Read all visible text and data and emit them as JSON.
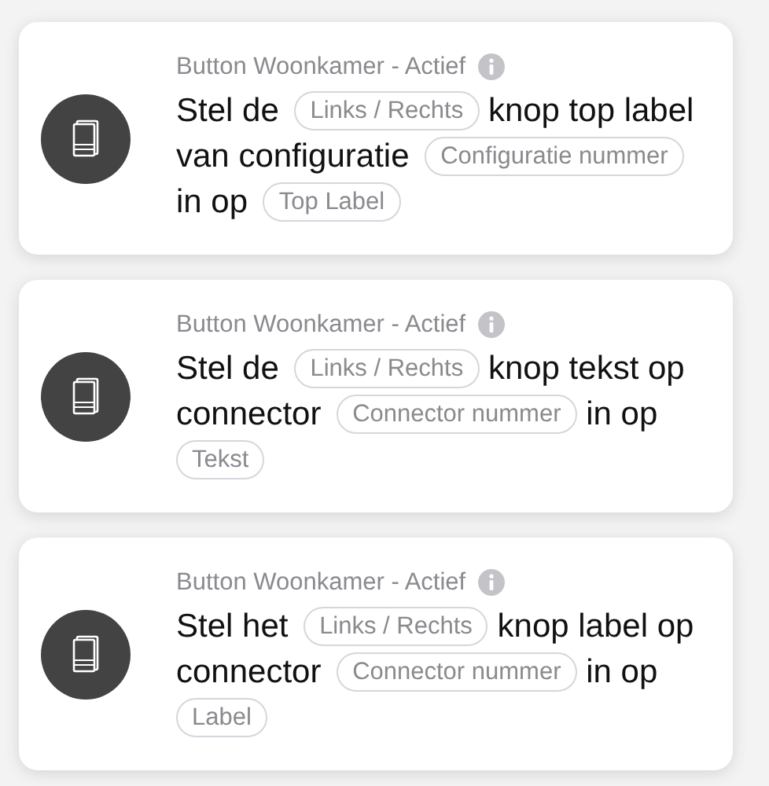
{
  "cards": [
    {
      "title": "Button Woonkamer - Actief",
      "sentence": [
        {
          "kind": "text",
          "text": "Stel de"
        },
        {
          "kind": "field",
          "placeholder": "Links / Rechts"
        },
        {
          "kind": "text",
          "text": "knop top label"
        },
        {
          "kind": "text",
          "text": "van configuratie"
        },
        {
          "kind": "field",
          "placeholder": "Configuratie nummer"
        },
        {
          "kind": "text",
          "text": "in op"
        },
        {
          "kind": "field",
          "placeholder": "Top Label"
        }
      ]
    },
    {
      "title": "Button Woonkamer - Actief",
      "sentence": [
        {
          "kind": "text",
          "text": "Stel de"
        },
        {
          "kind": "field",
          "placeholder": "Links / Rechts"
        },
        {
          "kind": "text",
          "text": "knop tekst op"
        },
        {
          "kind": "text",
          "text": "connector"
        },
        {
          "kind": "field",
          "placeholder": "Connector nummer"
        },
        {
          "kind": "text",
          "text": "in op"
        },
        {
          "kind": "field",
          "placeholder": "Tekst"
        }
      ]
    },
    {
      "title": "Button Woonkamer - Actief",
      "sentence": [
        {
          "kind": "text",
          "text": "Stel het"
        },
        {
          "kind": "field",
          "placeholder": "Links / Rechts"
        },
        {
          "kind": "text",
          "text": "knop label op"
        },
        {
          "kind": "text",
          "text": "connector"
        },
        {
          "kind": "field",
          "placeholder": "Connector nummer"
        },
        {
          "kind": "text",
          "text": "in op"
        },
        {
          "kind": "field",
          "placeholder": "Label"
        }
      ]
    }
  ]
}
